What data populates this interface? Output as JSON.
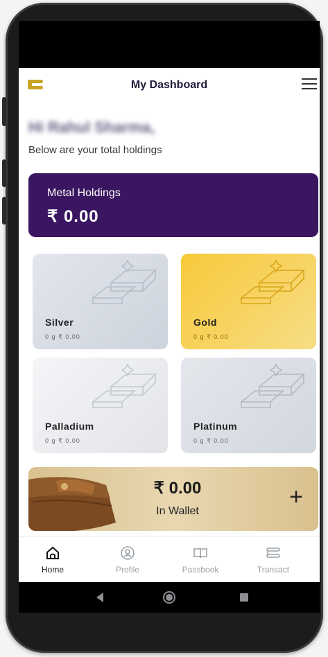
{
  "header": {
    "title": "My Dashboard",
    "logo_icon": "app-logo-icon",
    "menu_icon": "hamburger-menu-icon"
  },
  "greeting": "Hi Rahul Sharma,",
  "subtitle": "Below are your total holdings",
  "holdings": {
    "label": "Metal Holdings",
    "value": "₹ 0.00",
    "color": "#3a1560"
  },
  "metals": [
    {
      "name": "Silver",
      "summary": "0 g  ₹ 0.00"
    },
    {
      "name": "Gold",
      "summary": "0 g  ₹ 0.00"
    },
    {
      "name": "Palladium",
      "summary": "0 g  ₹ 0.00"
    },
    {
      "name": "Platinum",
      "summary": "0 g  ₹ 0.00"
    }
  ],
  "wallet": {
    "amount": "₹ 0.00",
    "label": "In Wallet",
    "add": "+"
  },
  "tabs": [
    {
      "label": "Home",
      "icon": "home-icon",
      "active": true
    },
    {
      "label": "Profile",
      "icon": "profile-icon"
    },
    {
      "label": "Passbook",
      "icon": "passbook-icon"
    },
    {
      "label": "Transact",
      "icon": "transact-icon"
    }
  ],
  "system_nav": [
    "back-icon",
    "home-circle-icon",
    "recents-icon"
  ]
}
